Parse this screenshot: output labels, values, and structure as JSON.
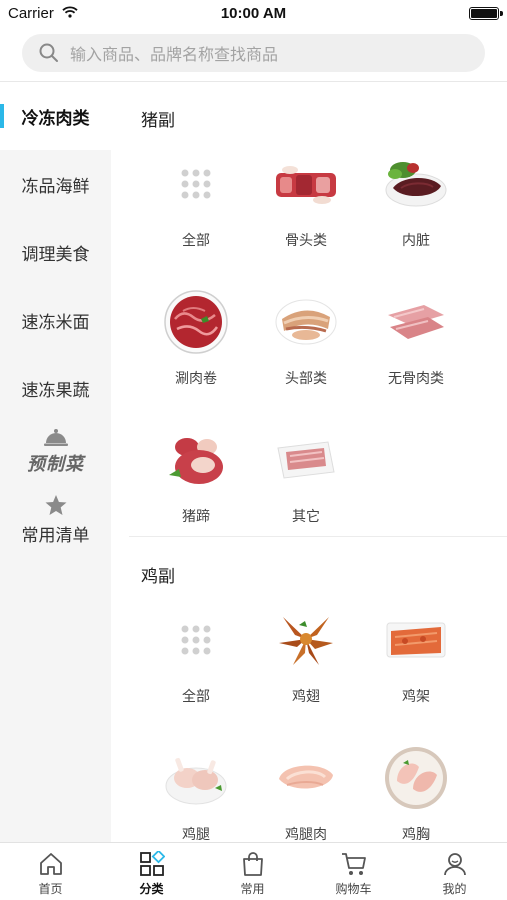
{
  "status_bar": {
    "carrier": "Carrier",
    "time": "10:00 AM"
  },
  "search": {
    "placeholder": "输入商品、品牌名称查找商品"
  },
  "sidebar": {
    "items": [
      {
        "label": "冷冻肉类",
        "active": true
      },
      {
        "label": "冻品海鲜",
        "active": false
      },
      {
        "label": "调理美食",
        "active": false
      },
      {
        "label": "速冻米面",
        "active": false
      },
      {
        "label": "速冻果蔬",
        "active": false
      }
    ],
    "brand_text": "预制菜",
    "favorites_label": "常用清单"
  },
  "sections": [
    {
      "title": "猪副",
      "items": [
        {
          "label": "全部",
          "icon": "grid-dots-icon"
        },
        {
          "label": "骨头类",
          "icon": "pork-bones-image"
        },
        {
          "label": "内脏",
          "icon": "pork-liver-image"
        },
        {
          "label": "涮肉卷",
          "icon": "meat-roll-image"
        },
        {
          "label": "头部类",
          "icon": "pork-head-image"
        },
        {
          "label": "无骨肉类",
          "icon": "boneless-meat-image"
        },
        {
          "label": "猪蹄",
          "icon": "pig-trotter-image"
        },
        {
          "label": "其它",
          "icon": "other-pork-image"
        }
      ]
    },
    {
      "title": "鸡副",
      "items": [
        {
          "label": "全部",
          "icon": "grid-dots-icon"
        },
        {
          "label": "鸡翅",
          "icon": "chicken-wings-image"
        },
        {
          "label": "鸡架",
          "icon": "chicken-frame-image"
        },
        {
          "label": "鸡腿",
          "icon": "chicken-legs-image"
        },
        {
          "label": "鸡腿肉",
          "icon": "chicken-thigh-image"
        },
        {
          "label": "鸡胸",
          "icon": "chicken-breast-image"
        }
      ]
    }
  ],
  "tabbar": {
    "tabs": [
      {
        "label": "首页",
        "icon": "home-icon",
        "active": false
      },
      {
        "label": "分类",
        "icon": "category-icon",
        "active": true
      },
      {
        "label": "常用",
        "icon": "bag-icon",
        "active": false
      },
      {
        "label": "购物车",
        "icon": "cart-icon",
        "active": false
      },
      {
        "label": "我的",
        "icon": "user-icon",
        "active": false
      }
    ]
  },
  "colors": {
    "accent": "#2bb8e8",
    "sidebar_bg": "#f5f5f5",
    "search_bg": "#efefef"
  }
}
